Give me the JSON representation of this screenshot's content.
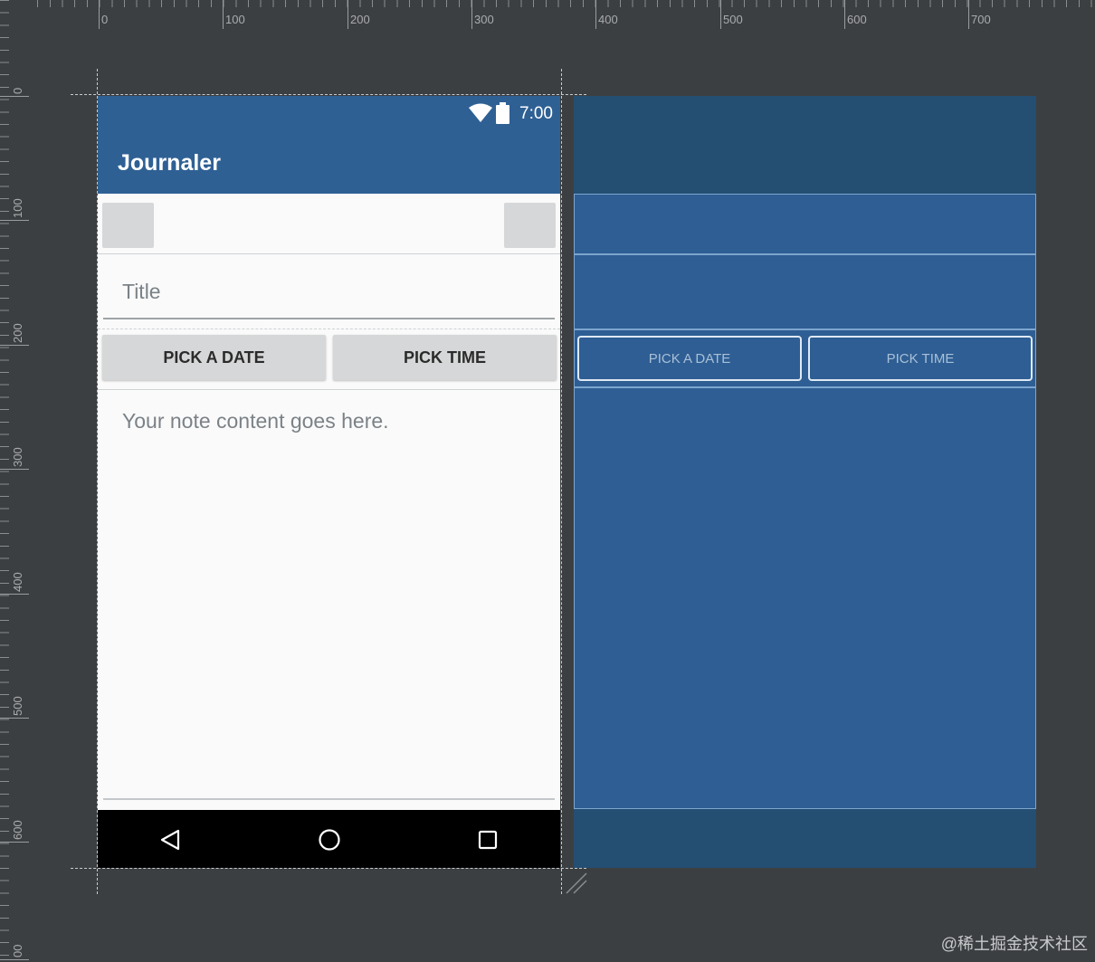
{
  "ruler": {
    "top_labels": [
      "0",
      "100",
      "200",
      "300",
      "400",
      "500",
      "600",
      "700"
    ],
    "left_labels": [
      "0",
      "100",
      "200",
      "300",
      "400",
      "500",
      "600",
      "00"
    ]
  },
  "status_bar": {
    "time": "7:00",
    "icons": [
      "wifi-icon",
      "battery-icon"
    ]
  },
  "toolbar": {
    "title": "Journaler"
  },
  "form": {
    "title_placeholder": "Title",
    "pick_date_label": "PICK A DATE",
    "pick_time_label": "PICK TIME",
    "content_placeholder": "Your note content goes here."
  },
  "nav_bar": {
    "icons": [
      "back-icon",
      "home-icon",
      "recents-icon"
    ]
  },
  "blueprint": {
    "pick_date_label": "PICK A DATE",
    "pick_time_label": "PICK TIME"
  },
  "watermark": "@稀土掘金技术社区",
  "colors": {
    "primary": "#2e6094",
    "blueprint": "#2e5e93",
    "canvas": "#3c3f41",
    "button": "#d6d7d8"
  }
}
